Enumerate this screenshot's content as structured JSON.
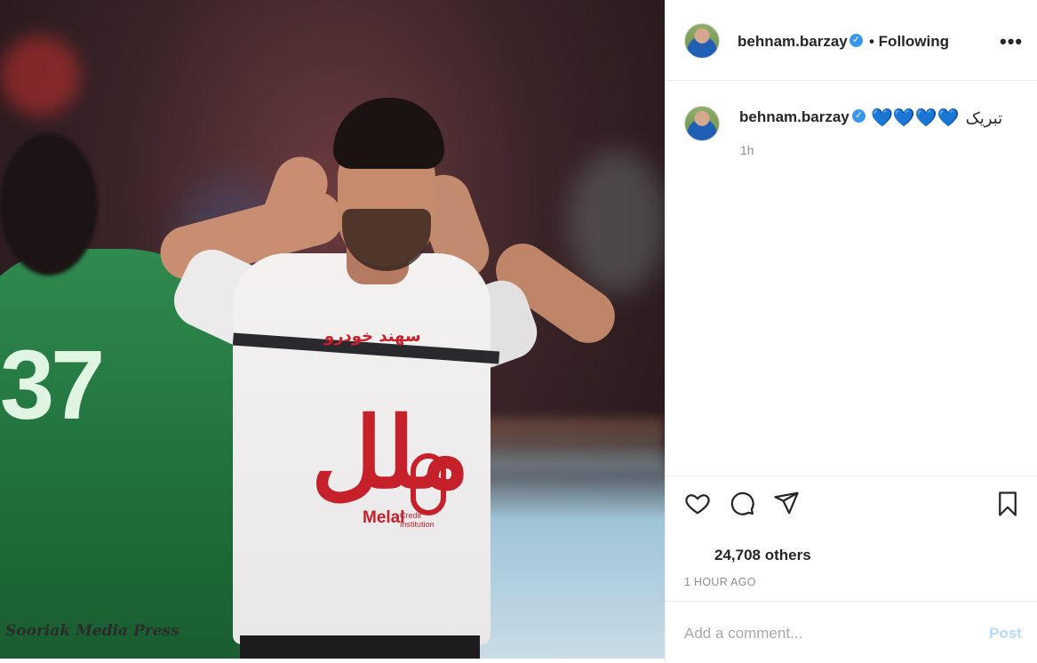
{
  "media": {
    "watermark": "Sooriak Media Press",
    "jersey_sponsor_top": "سهند خودرو",
    "jersey_logo_main": "ملل",
    "jersey_logo_name": "Melal",
    "jersey_logo_sub": "Credit Institution",
    "green_jersey_number": "37"
  },
  "header": {
    "username": "behnam.barzay",
    "verified_icon": "verified-badge-icon",
    "following_label": "• Following",
    "more_icon": "more-options-icon",
    "more_label": "•••"
  },
  "caption": {
    "username": "behnam.barzay",
    "hearts": "💙💙💙💙",
    "text": "تبریک",
    "time": "1h"
  },
  "actions": {
    "like_icon": "heart-outline-icon",
    "comment_icon": "comment-bubble-icon",
    "share_icon": "paper-plane-icon",
    "save_icon": "bookmark-icon"
  },
  "likes_text": "24,708 others",
  "timestamp": "1 HOUR AGO",
  "comment_box": {
    "placeholder": "Add a comment...",
    "post_label": "Post"
  },
  "colors": {
    "verified": "#3897f0",
    "post_disabled": "#b3dbff",
    "heart_blue": "#1da5e6"
  }
}
